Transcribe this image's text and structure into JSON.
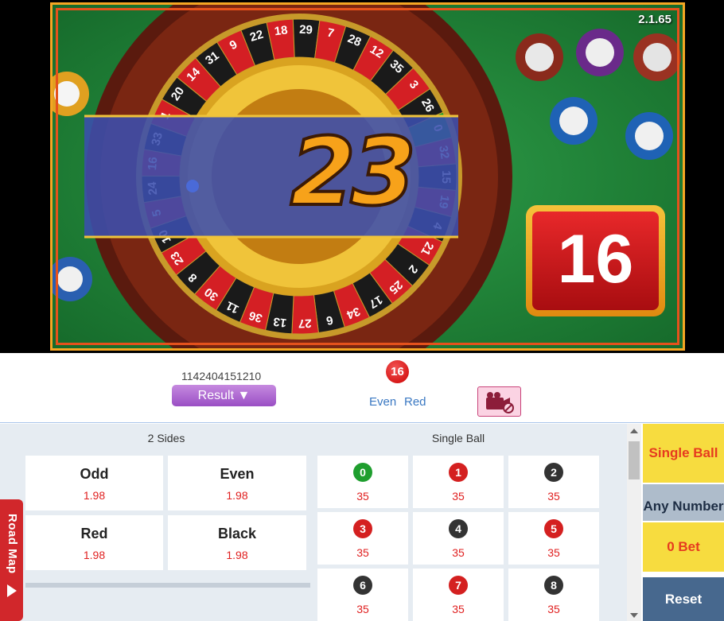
{
  "video": {
    "version": "2.1.65",
    "current_spin": "23",
    "last_result_display": "16",
    "wheel_numbers": [
      "0",
      "32",
      "15",
      "19",
      "4",
      "21",
      "2",
      "25",
      "17",
      "34",
      "6",
      "27",
      "13",
      "36",
      "11",
      "30",
      "8",
      "23",
      "10",
      "5",
      "24",
      "16",
      "33",
      "1",
      "20",
      "14",
      "31",
      "9",
      "22",
      "18",
      "29",
      "7",
      "28",
      "12",
      "35",
      "3",
      "26"
    ]
  },
  "info": {
    "round_id": "1142404151210",
    "result_button": "Result ▼",
    "last_ball": "16",
    "tag_parity": "Even",
    "tag_color": "Red"
  },
  "bet_area": {
    "two_sides_title": "2 Sides",
    "single_ball_title": "Single Ball",
    "sides": [
      {
        "name": "Odd",
        "odds": "1.98"
      },
      {
        "name": "Even",
        "odds": "1.98"
      },
      {
        "name": "Red",
        "odds": "1.98"
      },
      {
        "name": "Black",
        "odds": "1.98"
      }
    ],
    "balls": [
      {
        "number": "0",
        "color": "#1e9e2e",
        "odds": "35"
      },
      {
        "number": "1",
        "color": "#d42020",
        "odds": "35"
      },
      {
        "number": "2",
        "color": "#333333",
        "odds": "35"
      },
      {
        "number": "3",
        "color": "#d42020",
        "odds": "35"
      },
      {
        "number": "4",
        "color": "#333333",
        "odds": "35"
      },
      {
        "number": "5",
        "color": "#d42020",
        "odds": "35"
      },
      {
        "number": "6",
        "color": "#333333",
        "odds": "35"
      },
      {
        "number": "7",
        "color": "#d42020",
        "odds": "35"
      },
      {
        "number": "8",
        "color": "#333333",
        "odds": "35"
      }
    ]
  },
  "roadmap": {
    "label": "Road Map"
  },
  "right_panel": {
    "single_ball": "Single Ball",
    "any_number": "Any Number",
    "bet_total": "0 Bet",
    "reset": "Reset"
  }
}
